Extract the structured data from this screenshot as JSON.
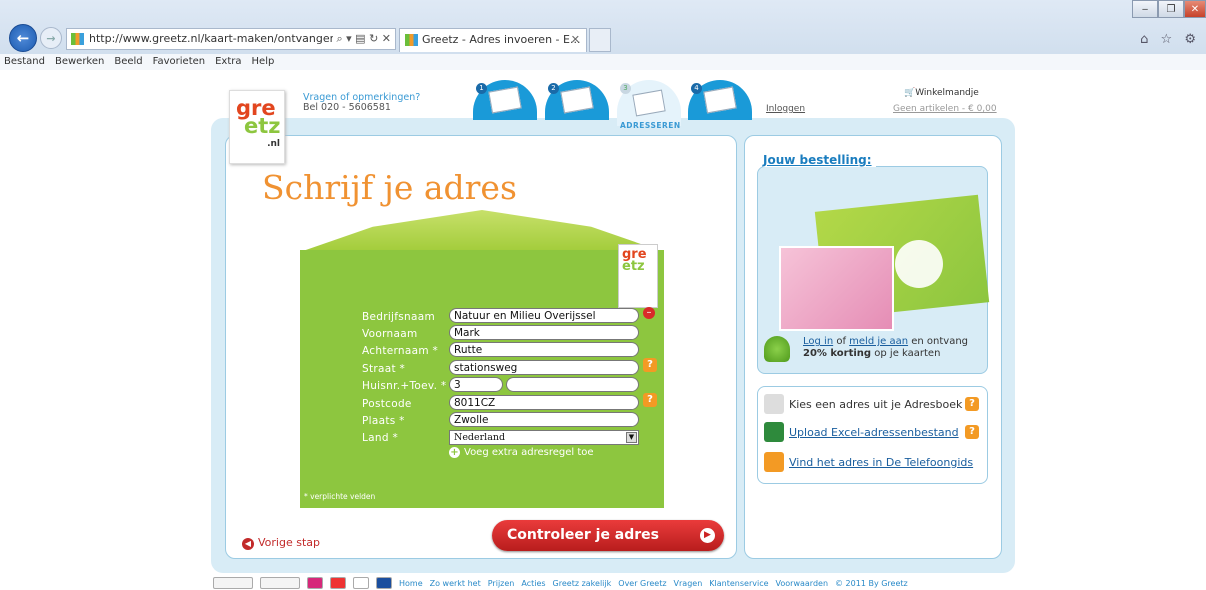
{
  "browser": {
    "url": "http://www.greetz.nl/kaart-maken/ontvangers-toev",
    "url_tools": "⌕ ▾ ▤ ↻ ✕",
    "tab_title": "Greetz - Adres invoeren - E...",
    "tab_close": "✕",
    "toolbar_icons": "⌂ ☆ ⚙",
    "window_buttons": [
      "‒",
      "❐",
      "✕"
    ],
    "menu": [
      "Bestand",
      "Bewerken",
      "Beeld",
      "Favorieten",
      "Extra",
      "Help"
    ]
  },
  "header": {
    "logo_text": [
      "gre",
      "etz",
      ".nl"
    ],
    "contact_line1": "Vragen of opmerkingen?",
    "contact_line2": "Bel 020 - 5606581",
    "steps": [
      "1",
      "2",
      "3",
      "4"
    ],
    "active_step_label": "ADRESSEREN",
    "login": "Inloggen",
    "cart_title": "Winkelmandje",
    "cart_sub": "Geen artikelen - € 0,00"
  },
  "form": {
    "title": "Schrijf je adres",
    "fields": {
      "bedrijfsnaam": {
        "label": "Bedrijfsnaam",
        "value": "Natuur en Milieu Overijssel"
      },
      "voornaam": {
        "label": "Voornaam",
        "value": "Mark"
      },
      "achternaam": {
        "label": "Achternaam *",
        "value": "Rutte"
      },
      "straat": {
        "label": "Straat *",
        "value": "stationsweg"
      },
      "huisnr": {
        "label": "Huisnr.+Toev. *",
        "value": "3",
        "toevoeging": ""
      },
      "postcode": {
        "label": "Postcode",
        "value": "8011CZ"
      },
      "plaats": {
        "label": "Plaats *",
        "value": "Zwolle"
      },
      "land": {
        "label": "Land *",
        "value": "Nederland"
      }
    },
    "add_line": "Voeg extra adresregel toe",
    "required_note": "* verplichte velden",
    "prev": "Vorige stap",
    "submit": "Controleer je adres",
    "help_glyph": "?",
    "remove_glyph": "–"
  },
  "sidebar": {
    "order_title": "Jouw bestelling:",
    "promo_login": "Log in",
    "promo_of": " of ",
    "promo_register": "meld je aan",
    "promo_rest": " en ontvang",
    "promo_bold": "20% korting",
    "promo_tail": " op je kaarten",
    "tools": [
      {
        "label": "Kies een adres uit je Adresboek",
        "link": false
      },
      {
        "label": "Upload Excel-adressenbestand",
        "link": true
      },
      {
        "label": "Vind het adres in De Telefoongids",
        "link": true
      }
    ]
  },
  "footer": {
    "links": [
      "Home",
      "Zo werkt het",
      "Prijzen",
      "Acties",
      "Greetz zakelijk",
      "Over Greetz",
      "Vragen",
      "Klantenservice",
      "Voorwaarden",
      "© 2011 By Greetz"
    ]
  }
}
